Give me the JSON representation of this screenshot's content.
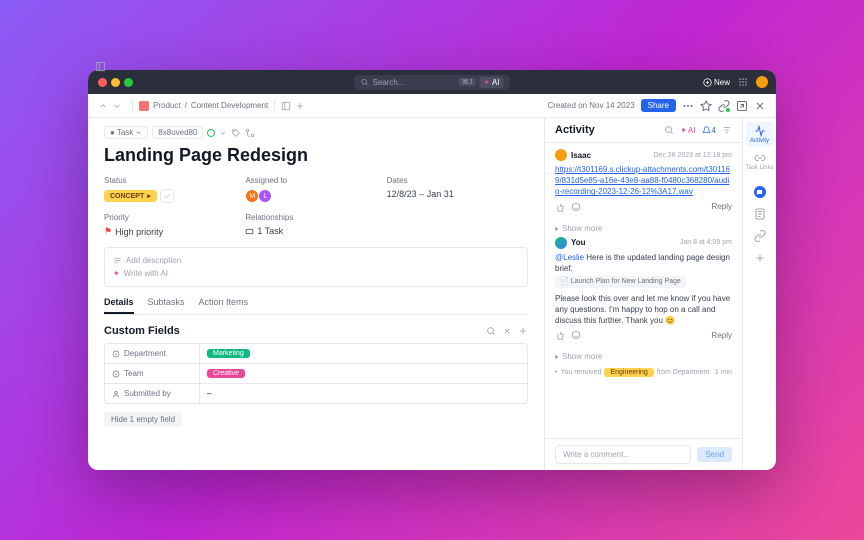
{
  "search": {
    "placeholder": "Search...",
    "kbd": "⌘J",
    "ai": "AI"
  },
  "topbar": {
    "new": "New"
  },
  "toolbar": {
    "breadcrumb": [
      "Product",
      "Content Development"
    ],
    "created": "Created on Nov 14 2023",
    "share": "Share"
  },
  "task": {
    "type_label": "Task",
    "id": "8x8uved80",
    "title": "Landing Page Redesign",
    "fields": {
      "status": {
        "label": "Status",
        "value": "CONCEPT"
      },
      "assigned": {
        "label": "Assigned to"
      },
      "dates": {
        "label": "Dates",
        "value": "12/8/23 – Jan 31"
      },
      "priority": {
        "label": "Priority",
        "value": "High priority"
      },
      "relationships": {
        "label": "Relationships",
        "value": "1 Task"
      }
    },
    "desc": {
      "add": "Add description",
      "ai": "Write with AI"
    },
    "tabs": [
      "Details",
      "Subtasks",
      "Action Items"
    ],
    "custom_fields": {
      "title": "Custom Fields",
      "rows": [
        {
          "name": "Department",
          "tag": "Marketing",
          "cls": "tag-marketing"
        },
        {
          "name": "Team",
          "tag": "Creative",
          "cls": "tag-creative"
        },
        {
          "name": "Submitted by",
          "value": "–"
        }
      ],
      "hide": "Hide 1 empty field"
    }
  },
  "activity": {
    "title": "Activity",
    "ai": "AI",
    "notif_count": "4",
    "posts": [
      {
        "user": "Isaac",
        "time": "Dec 26 2023 at 12:18 pm",
        "link": "https://t301169.s.clickup-attachments.com/t301169/831d5e85-a16e-43e8-aa88-f0480c368280/audio-recording-2023-12-26-12%3A17.wav",
        "avatar_bg": "#F59E0B"
      },
      {
        "user": "You",
        "time": "Jan 8 at 4:09 pm",
        "mention": "@Leslie",
        "text1": " Here is the updated landing page design brief.",
        "attach": "Launch Plan for New Landing Page",
        "text2": "Please look this over and let me know if you have any questions. I'm happy to hop on a call and discuss this further. Thank you 😊",
        "avatar_bg": "linear-gradient(135deg,#10B981,#3B82F6)"
      }
    ],
    "show_more": "Show more",
    "reply": "Reply",
    "log": {
      "text1": "You removed",
      "tag": "Engineering",
      "text2": "from Department",
      "time": "1 min"
    },
    "comment_placeholder": "Write a comment...",
    "send": "Send"
  },
  "rail": {
    "items": [
      {
        "label": "Activity"
      },
      {
        "label": "Task Links"
      }
    ]
  }
}
